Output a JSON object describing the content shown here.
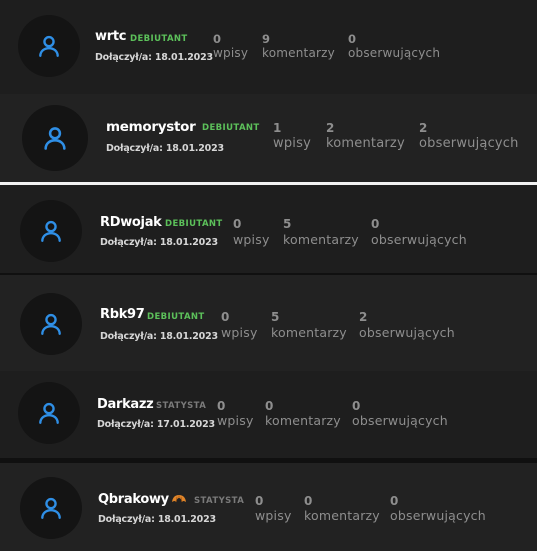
{
  "users": [
    {
      "username": "wrtc",
      "role": "DEBIUTANT",
      "role_kind": "debiutant",
      "joined": "Dołączył/a: 18.01.2023",
      "stats": [
        {
          "value": "0",
          "label": "wpisy"
        },
        {
          "value": "9",
          "label": "komentarzy"
        },
        {
          "value": "0",
          "label": "obserwujących"
        }
      ]
    },
    {
      "username": "memorystor",
      "role": "DEBIUTANT",
      "role_kind": "debiutant",
      "joined": "Dołączył/a: 18.01.2023",
      "stats": [
        {
          "value": "1",
          "label": "wpisy"
        },
        {
          "value": "2",
          "label": "komentarzy"
        },
        {
          "value": "2",
          "label": "obserwujących"
        }
      ]
    },
    {
      "username": "RDwojak",
      "role": "DEBIUTANT",
      "role_kind": "debiutant",
      "joined": "Dołączył/a: 18.01.2023",
      "stats": [
        {
          "value": "0",
          "label": "wpisy"
        },
        {
          "value": "5",
          "label": "komentarzy"
        },
        {
          "value": "0",
          "label": "obserwujących"
        }
      ]
    },
    {
      "username": "Rbk97",
      "role": "DEBIUTANT",
      "role_kind": "debiutant",
      "joined": "Dołączył/a: 18.01.2023",
      "stats": [
        {
          "value": "0",
          "label": "wpisy"
        },
        {
          "value": "5",
          "label": "komentarzy"
        },
        {
          "value": "2",
          "label": "obserwujących"
        }
      ]
    },
    {
      "username": "Darkazz",
      "role": "STATYSTA",
      "role_kind": "statysta",
      "joined": "Dołączył/a: 17.01.2023",
      "stats": [
        {
          "value": "0",
          "label": "wpisy"
        },
        {
          "value": "0",
          "label": "komentarzy"
        },
        {
          "value": "0",
          "label": "obserwujących"
        }
      ]
    },
    {
      "username": "Qbrakowy",
      "role": "STATYSTA",
      "role_kind": "statysta",
      "badge_icon": "croissant-icon",
      "joined": "Dołączył/a: 18.01.2023",
      "stats": [
        {
          "value": "0",
          "label": "wpisy"
        },
        {
          "value": "0",
          "label": "komentarzy"
        },
        {
          "value": "0",
          "label": "obserwujących"
        }
      ]
    }
  ],
  "colors": {
    "accent": "#2f8fe6",
    "debiutant": "#5cc05a",
    "statysta": "#7a7a7a",
    "stat_text": "#8e8e8e"
  }
}
